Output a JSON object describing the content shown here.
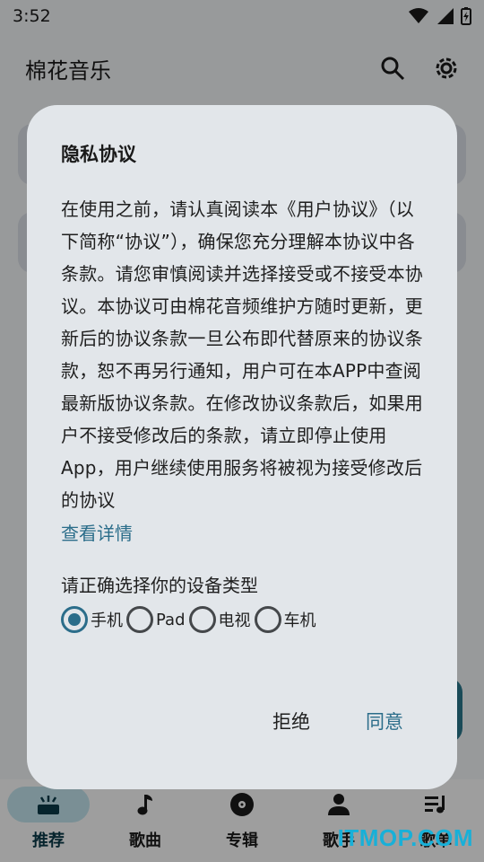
{
  "status_bar": {
    "time": "3:52"
  },
  "app_bar": {
    "title": "棉花音乐",
    "search_icon": "search-icon",
    "settings_icon": "gear-icon"
  },
  "dialog": {
    "title": "隐私协议",
    "body": "在使用之前，请认真阅读本《用户协议》（以下简称“协议”），确保您充分理解本协议中各条款。请您审慎阅读并选择接受或不接受本协议。本协议可由棉花音频维护方随时更新，更新后的协议条款一旦公布即代替原来的协议条款，恕不再另行通知，用户可在本APP中查阅最新版协议条款。在修改协议条款后，如果用户不接受修改后的条款，请立即停止使用App，用户继续使用服务将被视为接受修改后的协议",
    "details_link": "查看详情",
    "device_prompt": "请正确选择你的设备类型",
    "device_options": [
      "手机",
      "Pad",
      "电视",
      "车机"
    ],
    "selected_device": "手机",
    "reject_label": "拒绝",
    "agree_label": "同意"
  },
  "bottom_nav": {
    "items": [
      {
        "label": "推荐",
        "icon": "recommend-icon",
        "active": true
      },
      {
        "label": "歌曲",
        "icon": "music-note-icon",
        "active": false
      },
      {
        "label": "专辑",
        "icon": "album-icon",
        "active": false
      },
      {
        "label": "歌手",
        "icon": "person-icon",
        "active": false
      },
      {
        "label": "歌单",
        "icon": "playlist-icon",
        "active": false
      }
    ]
  },
  "watermark": "ITMOP.COM",
  "colors": {
    "accent": "#2b6d8a",
    "active_nav_bg": "#c5e7f0",
    "dialog_bg": "#e2e6ea"
  }
}
